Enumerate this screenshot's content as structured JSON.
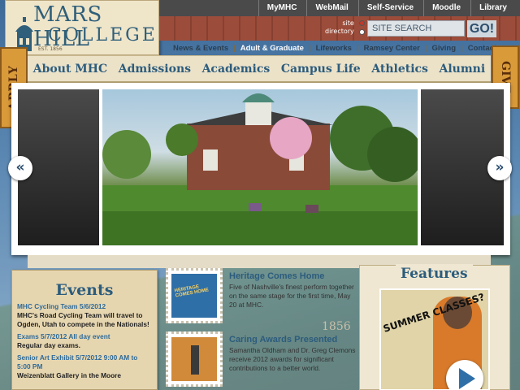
{
  "logo": {
    "line1": "MARS HILL",
    "line2": "COLLEGE",
    "est": "EST. 1856"
  },
  "utility": [
    "MyMHC",
    "WebMail",
    "Self-Service",
    "Moodle",
    "Library"
  ],
  "search": {
    "label1": "site",
    "label2": "directory",
    "placeholder": "SITE SEARCH",
    "button": "GO!"
  },
  "secondary_nav": [
    "News & Events",
    "Adult & Graduate",
    "Lifeworks",
    "Ramsey Center",
    "Giving",
    "Contact"
  ],
  "tabs": {
    "apply": "APPLY",
    "give": "GIVE"
  },
  "main_nav": [
    "About MHC",
    "Admissions",
    "Academics",
    "Campus Life",
    "Athletics",
    "Alumni"
  ],
  "slider": {
    "prev": "«",
    "next": "»"
  },
  "events": {
    "title": "Events",
    "items": [
      {
        "title": "MHC Cycling Team 5/6/2012",
        "desc": "MHC's Road Cycling Team will travel to Ogden, Utah to compete in the Nationals!"
      },
      {
        "title": "Exams 5/7/2012 All day event",
        "desc": "Regular day exams."
      },
      {
        "title": "Senior Art Exhibit 5/7/2012 9:00 AM to 5:00 PM",
        "desc": "Weizenblatt Gallery in the Moore"
      }
    ]
  },
  "news": [
    {
      "title": "Heritage Comes Home",
      "desc": "Five of Nashville's finest perform together on the same stage for the first time, May 20 at MHC.",
      "stamp": "HERITAGE COMES HOME"
    },
    {
      "title": "Caring Awards Presented",
      "desc": "Samantha Oldham and Dr. Greg Clemons receive 2012 awards for significant contributions to a better world.",
      "stamp": ""
    }
  ],
  "postmark": "1856",
  "features": {
    "title": "Features",
    "video_text": "SUMMER CLASSES?"
  },
  "colors": {
    "accent": "#2c5c7d",
    "topbar": "#4a4a4a",
    "brick": "#9c4c3a",
    "tab": "#d99a3a"
  }
}
